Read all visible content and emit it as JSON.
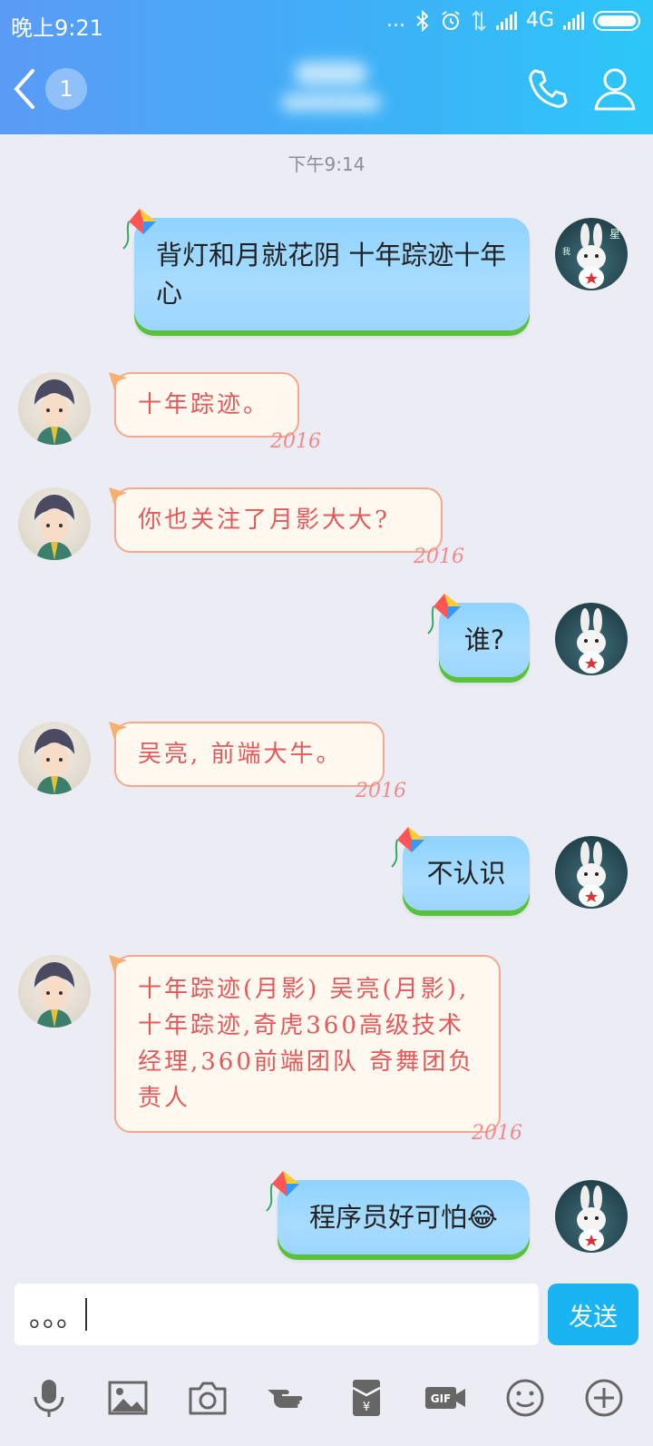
{
  "status": {
    "time": "晚上9:21",
    "dots": "...",
    "network": "4G"
  },
  "header": {
    "back_count": "1"
  },
  "chat": {
    "time_label": "下午9:14",
    "messages": [
      {
        "side": "out",
        "text": "背灯和月就花阴 十年踪迹十年心"
      },
      {
        "side": "in",
        "text": "十年踪迹。"
      },
      {
        "side": "in",
        "text": "你也关注了月影大大?"
      },
      {
        "side": "out",
        "text": "谁?"
      },
      {
        "side": "in",
        "text": "吴亮, 前端大牛。"
      },
      {
        "side": "out",
        "text": "不认识"
      },
      {
        "side": "in",
        "text": "十年踪迹(月影) 吴亮(月影), 十年踪迹,奇虎360高级技术经理,360前端团队 奇舞团负责人"
      },
      {
        "side": "out",
        "text": "程序员好可怕😂"
      }
    ],
    "bubble_deco": "2016"
  },
  "input": {
    "value": "。。。",
    "send_label": "发送"
  },
  "colors": {
    "header_start": "#5a9bf6",
    "header_end": "#2cc7f8",
    "send": "#1ab4f3",
    "in_text": "#e5585a"
  },
  "icons": [
    "mic-icon",
    "image-icon",
    "camera-icon",
    "hand-icon",
    "redpacket-icon",
    "gif-icon",
    "emoji-icon",
    "plus-icon"
  ]
}
